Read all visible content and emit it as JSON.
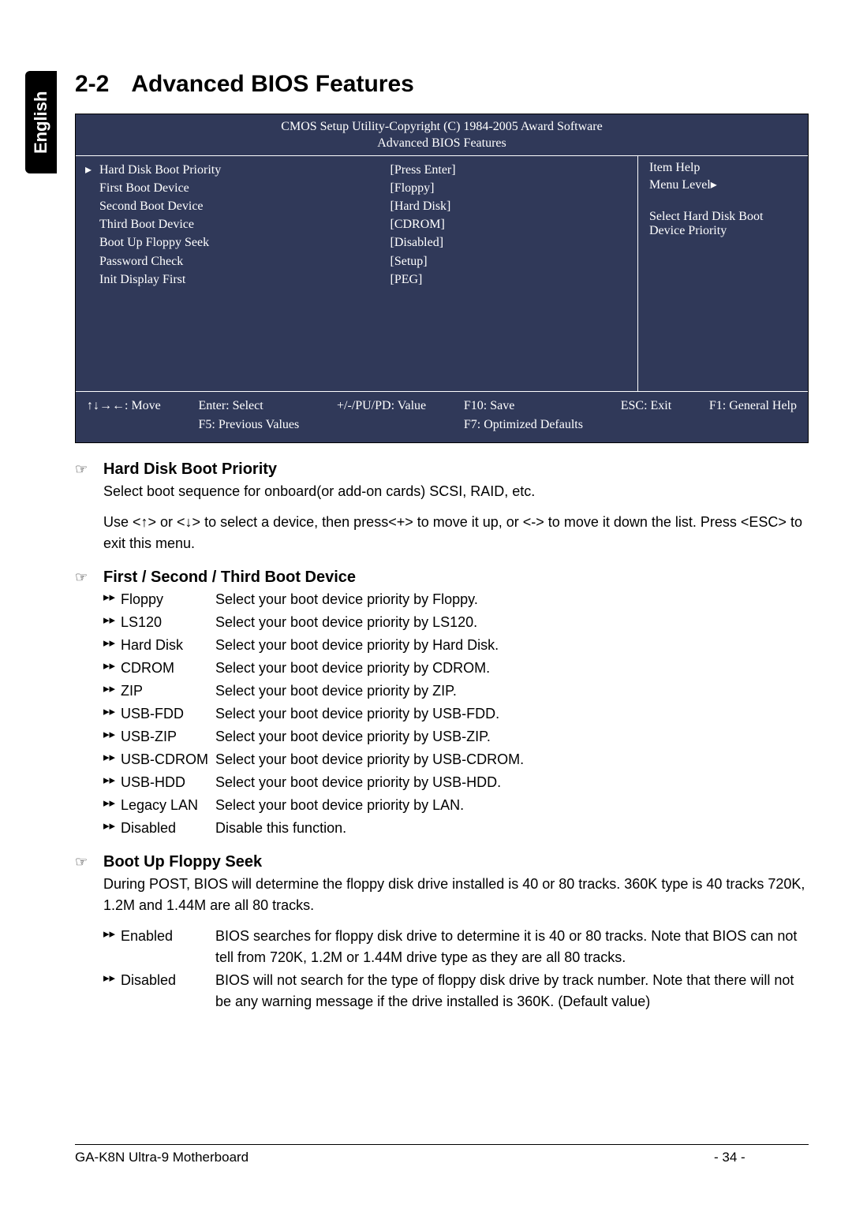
{
  "sidebar_label": "English",
  "section": {
    "number": "2-2",
    "title": "Advanced BIOS Features"
  },
  "bios": {
    "header_line1": "CMOS Setup Utility-Copyright (C) 1984-2005 Award Software",
    "header_line2": "Advanced BIOS Features",
    "settings": [
      {
        "arrow": "▸",
        "label": "Hard Disk Boot Priority",
        "value": "[Press Enter]"
      },
      {
        "arrow": "",
        "label": "First Boot Device",
        "value": "[Floppy]"
      },
      {
        "arrow": "",
        "label": "Second Boot Device",
        "value": "[Hard Disk]"
      },
      {
        "arrow": "",
        "label": "Third Boot Device",
        "value": "[CDROM]"
      },
      {
        "arrow": "",
        "label": "Boot Up Floppy Seek",
        "value": "[Disabled]"
      },
      {
        "arrow": "",
        "label": "Password Check",
        "value": "[Setup]"
      },
      {
        "arrow": "",
        "label": "Init Display First",
        "value": "[PEG]"
      }
    ],
    "help_title": "Item Help",
    "menu_level": "Menu Level▸",
    "help_text_1": "Select Hard Disk Boot",
    "help_text_2": "Device Priority",
    "footer": {
      "c1a": "↑↓→←: Move",
      "c1b": "",
      "c2a": "Enter: Select",
      "c2b": "F5: Previous Values",
      "c3a": "+/-/PU/PD: Value",
      "c3b": "",
      "c4a": "F10: Save",
      "c4b": "F7: Optimized Defaults",
      "c5a": "ESC: Exit",
      "c5b": "",
      "c6a": "F1: General Help",
      "c6b": ""
    }
  },
  "items": [
    {
      "title": "Hard Disk Boot Priority",
      "paras": [
        "Select boot sequence for onboard(or add-on cards) SCSI, RAID, etc.",
        "Use <↑> or <↓> to select a device, then press<+> to move it up, or <-> to move it down the list. Press <ESC> to exit this menu."
      ],
      "options": []
    },
    {
      "title": "First / Second / Third Boot Device",
      "paras": [],
      "options": [
        {
          "name": "Floppy",
          "desc": "Select your boot device priority by Floppy."
        },
        {
          "name": "LS120",
          "desc": "Select your boot device priority by LS120."
        },
        {
          "name": "Hard Disk",
          "desc": "Select your boot device priority by Hard Disk."
        },
        {
          "name": "CDROM",
          "desc": "Select your boot device priority by CDROM."
        },
        {
          "name": "ZIP",
          "desc": "Select your boot device priority by ZIP."
        },
        {
          "name": "USB-FDD",
          "desc": "Select your boot device priority by USB-FDD."
        },
        {
          "name": "USB-ZIP",
          "desc": "Select your boot device priority by USB-ZIP."
        },
        {
          "name": "USB-CDROM",
          "desc": "Select your boot device priority by USB-CDROM."
        },
        {
          "name": "USB-HDD",
          "desc": "Select your boot device priority by USB-HDD."
        },
        {
          "name": "Legacy LAN",
          "desc": "Select your boot device priority by LAN."
        },
        {
          "name": "Disabled",
          "desc": "Disable this function."
        }
      ]
    },
    {
      "title": "Boot Up Floppy Seek",
      "paras": [
        "During POST, BIOS will determine the floppy disk drive installed is 40 or 80 tracks. 360K type is 40 tracks 720K, 1.2M and 1.44M are all 80 tracks."
      ],
      "options": [
        {
          "name": "Enabled",
          "desc": "BIOS searches for floppy disk drive to determine it is 40 or 80 tracks. Note that BIOS can not tell from 720K, 1.2M or 1.44M drive type as they are all 80 tracks."
        },
        {
          "name": "Disabled",
          "desc": "BIOS will not search for the type of floppy disk drive by track number. Note that there will not be any warning message if the drive installed is 360K. (Default value)"
        }
      ]
    }
  ],
  "footer": {
    "left": "GA-K8N Ultra-9 Motherboard",
    "page": "- 34 -"
  }
}
